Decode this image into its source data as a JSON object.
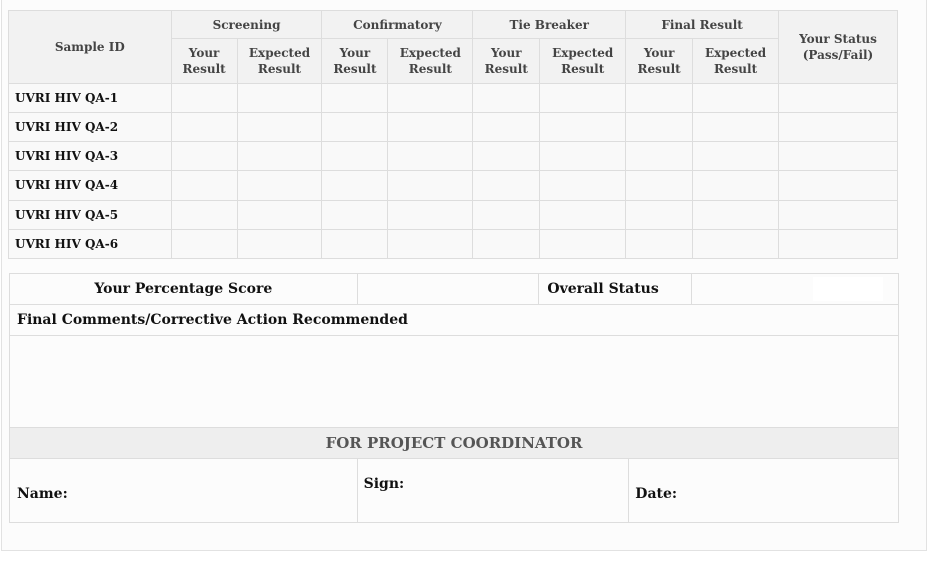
{
  "header": {
    "sample_id": "Sample ID",
    "groups": [
      "Screening",
      "Confirmatory",
      "Tie Breaker",
      "Final Result"
    ],
    "your_result": "Your Result",
    "expected_result": "Expected Result",
    "status": "Your Status (Pass/Fail)"
  },
  "samples": [
    "UVRI HIV QA-1",
    "UVRI HIV QA-2",
    "UVRI HIV QA-3",
    "UVRI HIV QA-4",
    "UVRI HIV QA-5",
    "UVRI HIV QA-6"
  ],
  "summary": {
    "percentage_label": "Your Percentage Score",
    "overall_label": "Overall Status",
    "comments_label": "Final Comments/Corrective Action Recommended",
    "coordinator_heading": "FOR PROJECT COORDINATOR",
    "name_label": "Name:",
    "sign_label": "Sign:",
    "date_label": "Date:"
  }
}
